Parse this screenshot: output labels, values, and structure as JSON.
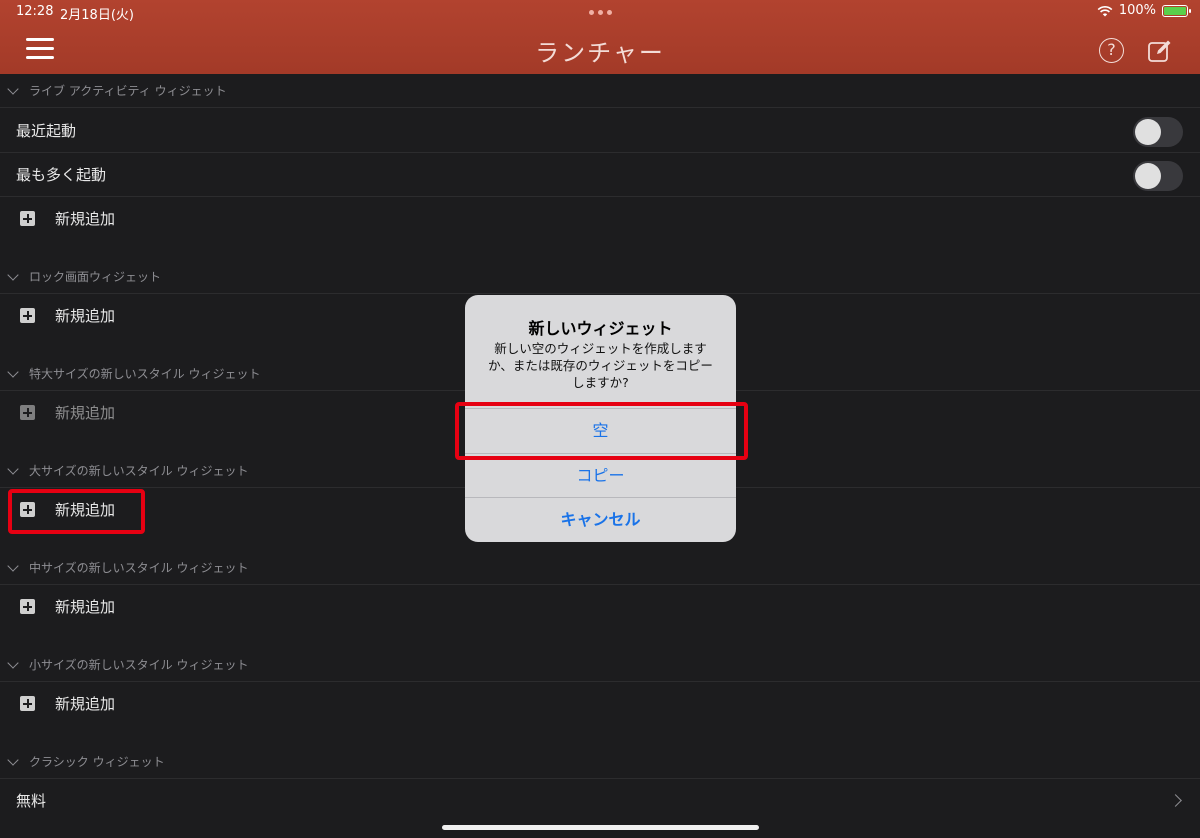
{
  "status": {
    "time": "12:28",
    "date": "2月18日(火)",
    "battery_text": "100%"
  },
  "header": {
    "title": "ランチャー",
    "help_label": "?"
  },
  "sections": [
    {
      "title": "ライブ アクティビティ ウィジェット",
      "rows": [
        {
          "label": "最近起動",
          "kind": "toggle",
          "on": false
        },
        {
          "label": "最も多く起動",
          "kind": "toggle",
          "on": false
        },
        {
          "label": "新規追加",
          "kind": "add"
        }
      ]
    },
    {
      "title": "ロック画面ウィジェット",
      "rows": [
        {
          "label": "新規追加",
          "kind": "add"
        }
      ]
    },
    {
      "title": "特大サイズの新しいスタイル ウィジェット",
      "rows": [
        {
          "label": "新規追加",
          "kind": "add",
          "dimmed": true
        }
      ]
    },
    {
      "title": "大サイズの新しいスタイル ウィジェット",
      "rows": [
        {
          "label": "新規追加",
          "kind": "add"
        }
      ]
    },
    {
      "title": "中サイズの新しいスタイル ウィジェット",
      "rows": [
        {
          "label": "新規追加",
          "kind": "add"
        }
      ]
    },
    {
      "title": "小サイズの新しいスタイル ウィジェット",
      "rows": [
        {
          "label": "新規追加",
          "kind": "add"
        }
      ]
    },
    {
      "title": "クラシック ウィジェット",
      "rows": [
        {
          "label": "無料",
          "kind": "nav"
        }
      ]
    }
  ],
  "alert": {
    "title": "新しいウィジェット",
    "message": "新しい空のウィジェットを作成しますか、または既存のウィジェットをコピーしますか?",
    "buttons": [
      "空",
      "コピー",
      "キャンセル"
    ]
  },
  "colors": {
    "header": "#a83d2b",
    "background": "#1c1c1e",
    "accent_blue": "#1a73e8",
    "highlight_red": "#e60012"
  }
}
